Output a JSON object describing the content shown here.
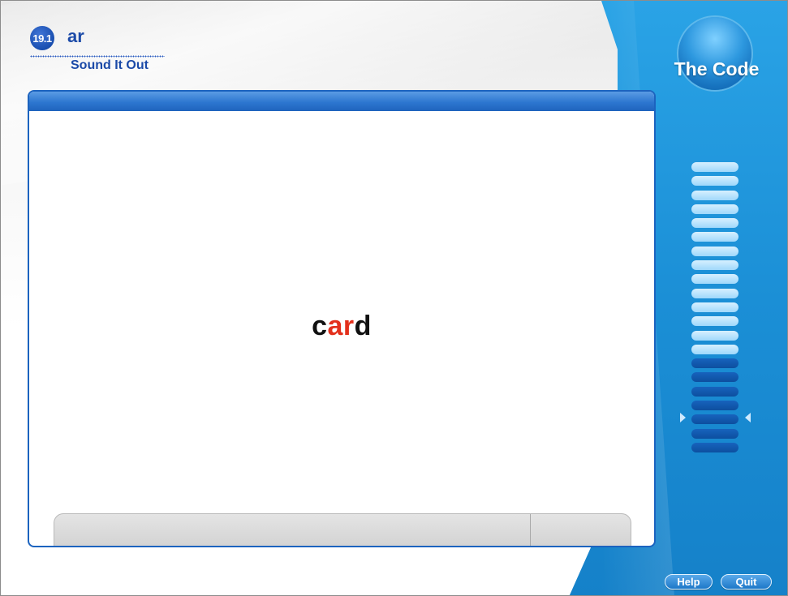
{
  "header": {
    "lesson_number": "19.1",
    "sound": "ar",
    "activity": "Sound It Out",
    "app_title": "The Code"
  },
  "word": {
    "prefix": "c",
    "highlight": "ar",
    "suffix": "d"
  },
  "progress": {
    "total_segments": 21,
    "completed_segments": 14,
    "current_index": 14
  },
  "colors": {
    "accent_blue": "#1c63bf",
    "highlight_red": "#e3301c",
    "panel_blue": "#1b8fd6"
  },
  "footer": {
    "help_label": "Help",
    "quit_label": "Quit"
  }
}
